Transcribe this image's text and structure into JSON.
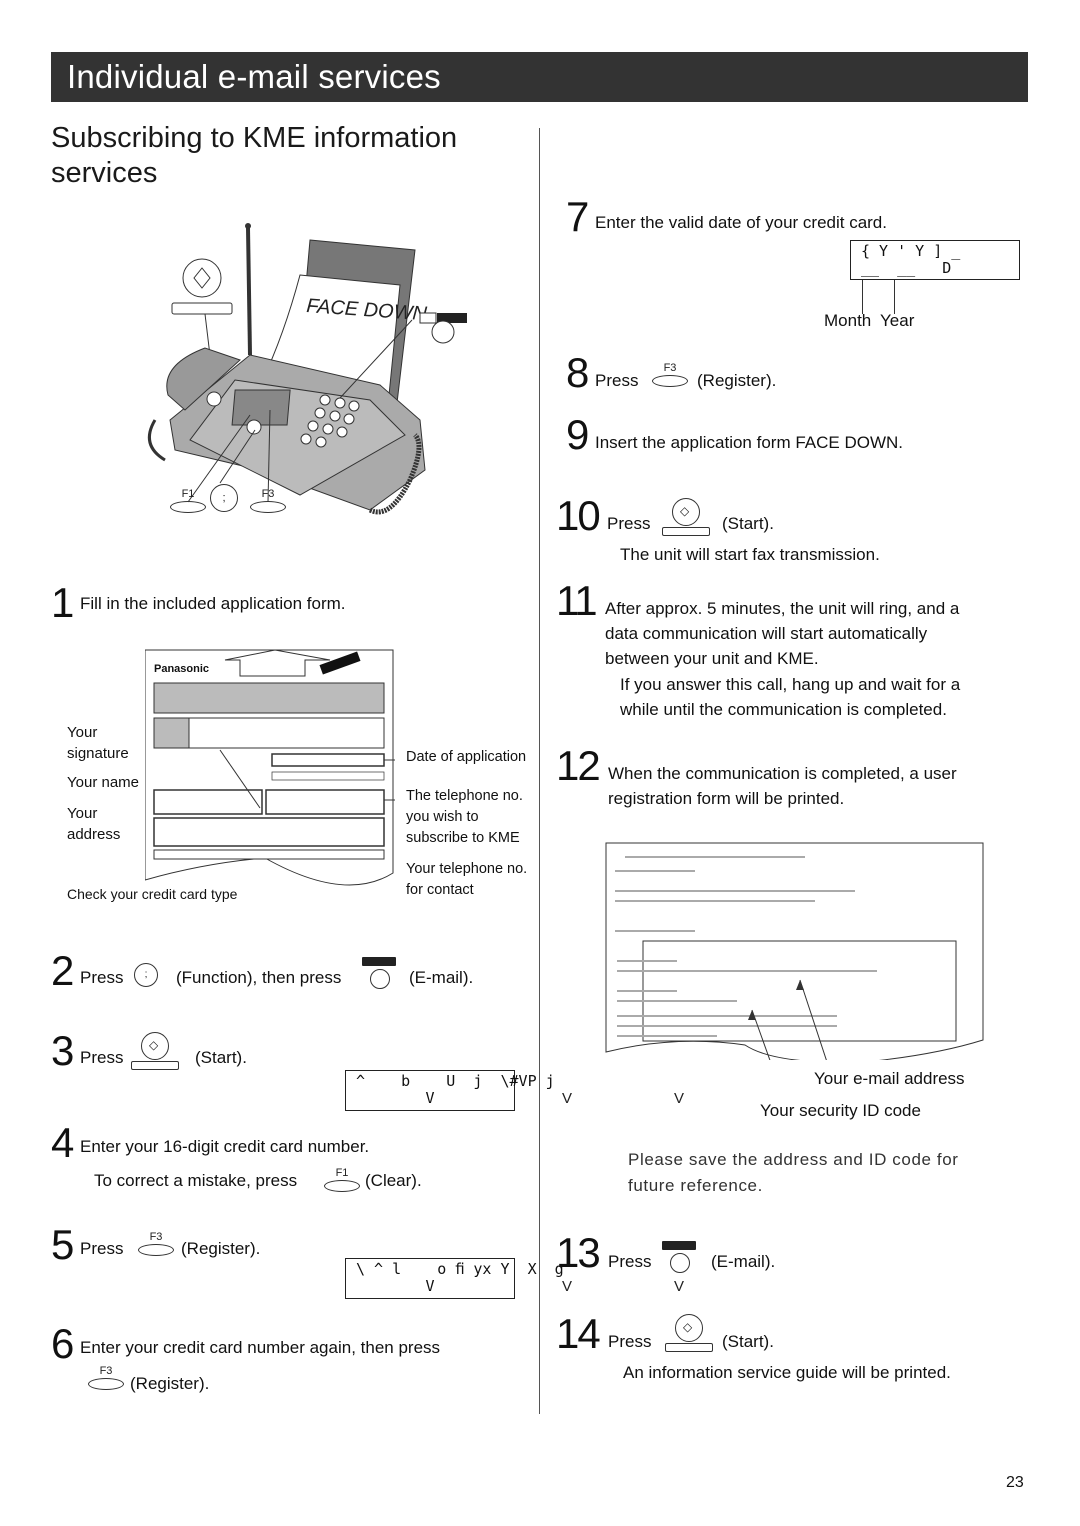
{
  "header": {
    "title": "Individual e-mail services"
  },
  "section": {
    "title": "Subscribing to KME information services"
  },
  "illustration": {
    "paper_label": "FACE DOWN",
    "email_key_label": "E-mail",
    "function_key_glyph": ";",
    "f1_label": "F1",
    "f3_label": "F3"
  },
  "form_figure": {
    "brand": "Panasonic",
    "callouts_left": [
      "Your signature",
      "Your name",
      "Your address",
      "Check your credit card type"
    ],
    "callouts_right": [
      "Date of application",
      "The telephone no. you wish to subscribe to KME",
      "Your telephone no. for contact"
    ]
  },
  "steps": [
    {
      "num": "1",
      "text": "Fill in the included application form."
    },
    {
      "num": "2",
      "pre": "Press",
      "mid": "(Function), then press",
      "post": "(E-mail)."
    },
    {
      "num": "3",
      "pre": "Press",
      "post": "(Start).",
      "lcd_line1": "^    b    U  j  \\#VP j",
      "lcd_line2": "V"
    },
    {
      "num": "4",
      "text": "Enter your 16-digit credit card number.",
      "sub_pre": "To correct a mistake, press",
      "sub_key": "F1",
      "sub_post": "(Clear)."
    },
    {
      "num": "5",
      "pre": "Press",
      "key": "F3",
      "post": "(Register).",
      "lcd_line1": "\\ ^ l    o ﬁ yx Y  X  g",
      "lcd_line2": "V"
    },
    {
      "num": "6",
      "text": "Enter your credit card number again, then press",
      "key": "F3",
      "post": "(Register)."
    },
    {
      "num": "7",
      "text": "Enter the valid date of your credit card.",
      "lcd_line1": "{ Y ' Y ] _",
      "lcd_line2": "__  __   D",
      "label_month": "Month",
      "label_year": "Year"
    },
    {
      "num": "8",
      "pre": "Press",
      "key": "F3",
      "post": "(Register)."
    },
    {
      "num": "9",
      "text": "Insert the application form FACE DOWN."
    },
    {
      "num": "10",
      "pre": "Press",
      "post": "(Start).",
      "sub": "The unit will start fax transmission."
    },
    {
      "num": "11",
      "text": "After approx. 5 minutes, the unit will ring, and a data communication will start automatically between your unit and KME.",
      "sub": "If you answer this call, hang up and wait for a while until the communication is completed."
    },
    {
      "num": "12",
      "text": "When the communication is completed, a user registration form will be printed."
    },
    {
      "num": "13",
      "pre": "Press",
      "post": "(E-mail)."
    },
    {
      "num": "14",
      "pre": "Press",
      "post": "(Start).",
      "sub": "An information service guide will be printed."
    }
  ],
  "printout": {
    "callout_email": "Your e-mail address",
    "callout_id": "Your security ID code",
    "note": "Please save the address and ID code for future reference."
  },
  "marks": {
    "v": "V"
  },
  "page_number": "23"
}
